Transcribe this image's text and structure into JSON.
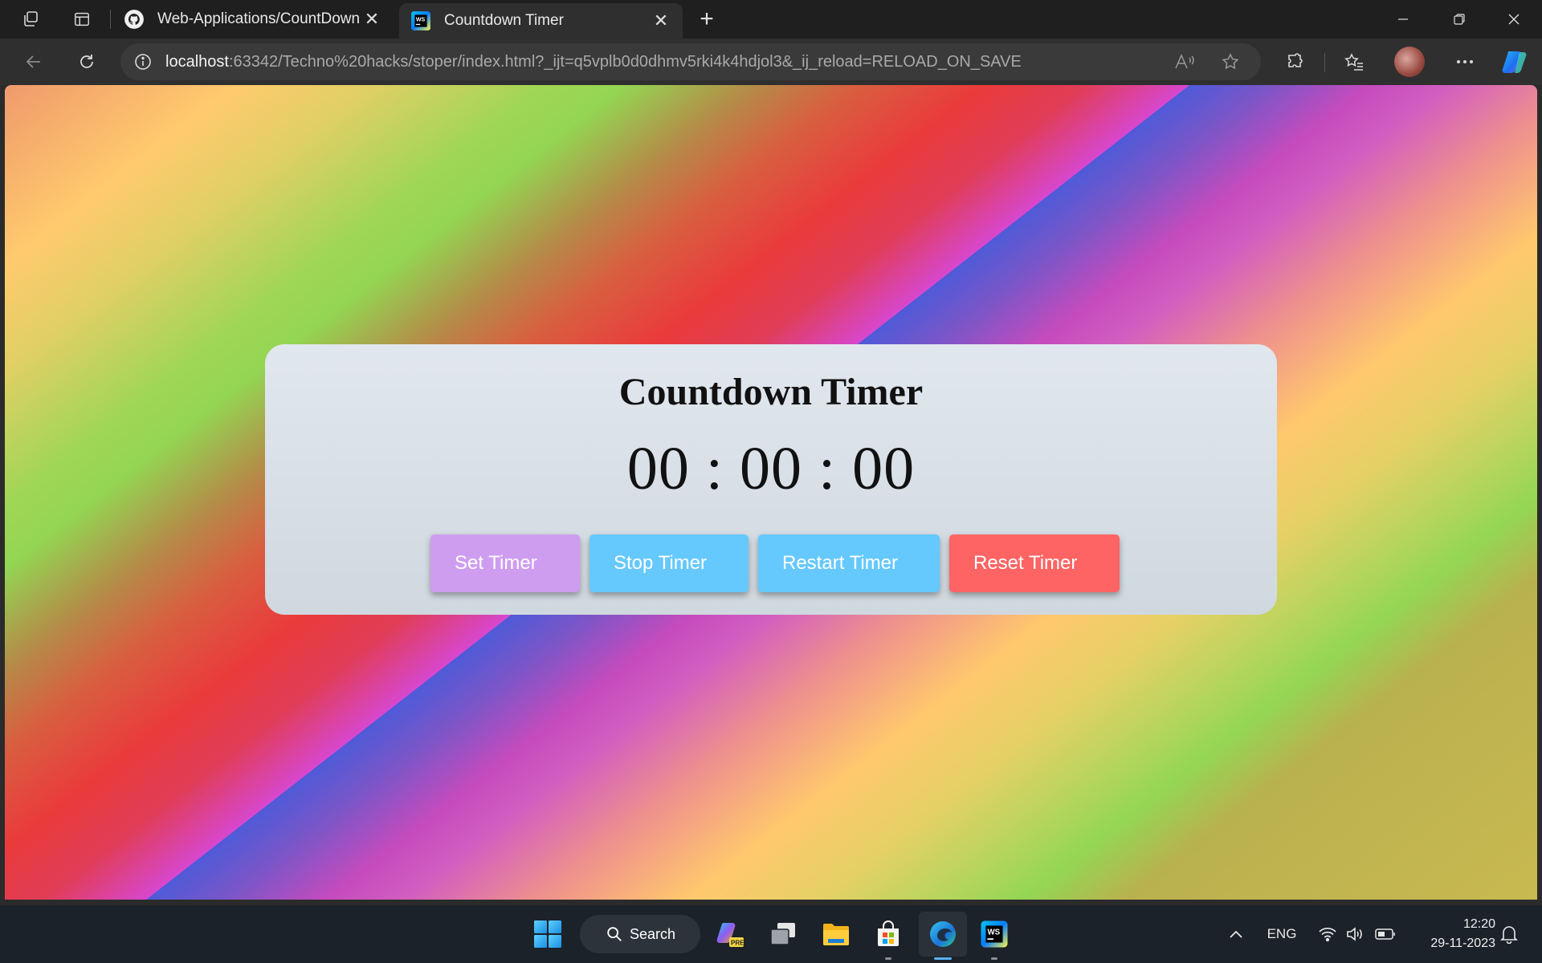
{
  "browser": {
    "tabs": [
      {
        "title": "Web-Applications/CountDown Ti",
        "icon": "github-icon",
        "active": false
      },
      {
        "title": "Countdown Timer",
        "icon": "webstorm-icon",
        "active": true
      }
    ],
    "url": {
      "host": "localhost",
      "rest": ":63342/Techno%20hacks/stoper/index.html?_ijt=q5vplb0d0dhmv5rki4k4hdjol3&_ij_reload=RELOAD_ON_SAVE"
    }
  },
  "page": {
    "title": "Countdown Timer",
    "display": "00 : 00 : 00",
    "buttons": {
      "set": "Set Timer",
      "stop": "Stop Timer",
      "restart": "Restart Timer",
      "reset": "Reset Timer"
    },
    "colors": {
      "set": "#cf9df0",
      "stop": "#66c9fe",
      "restart": "#66c9fe",
      "reset": "#ff6464"
    }
  },
  "taskbar": {
    "search_label": "Search",
    "language": "ENG",
    "time": "12:20",
    "date": "29-11-2023"
  }
}
